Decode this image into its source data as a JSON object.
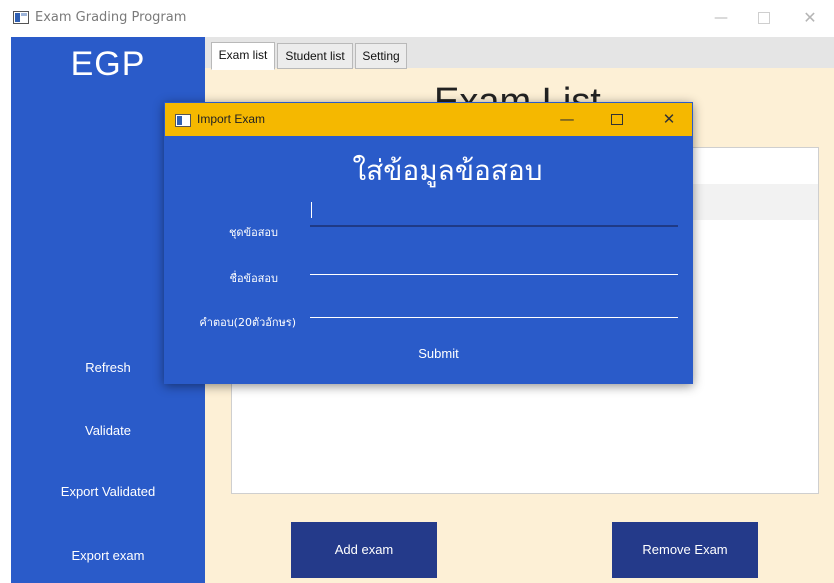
{
  "window": {
    "title": "Exam Grading Program",
    "controls": {
      "minimize": "—",
      "close": "✕"
    }
  },
  "sidebar": {
    "logo": "EGP",
    "buttons": [
      "Refresh",
      "Validate",
      "Export Validated",
      "Export exam"
    ]
  },
  "tabs": [
    {
      "label": "Exam list",
      "active": true
    },
    {
      "label": "Student list",
      "active": false
    },
    {
      "label": "Setting",
      "active": false
    }
  ],
  "main": {
    "title": "Exam List",
    "add_button": "Add exam",
    "remove_button": "Remove Exam"
  },
  "dialog": {
    "title": "Import Exam",
    "controls": {
      "minimize": "—",
      "close": "✕"
    },
    "heading": "ใส่ข้อมูลข้อสอบ",
    "fields": [
      {
        "label": "ชุดข้อสอบ",
        "value": ""
      },
      {
        "label": "ชื่อข้อสอบ",
        "value": ""
      },
      {
        "label": "คำตอบ(20ตัวอักษร)",
        "value": ""
      }
    ],
    "submit": "Submit"
  },
  "colors": {
    "sidebar": "#2a5bc9",
    "main_bg": "#fdf0d6",
    "dialog_titlebar": "#f5b800",
    "bottom_buttons": "#243a8a"
  }
}
